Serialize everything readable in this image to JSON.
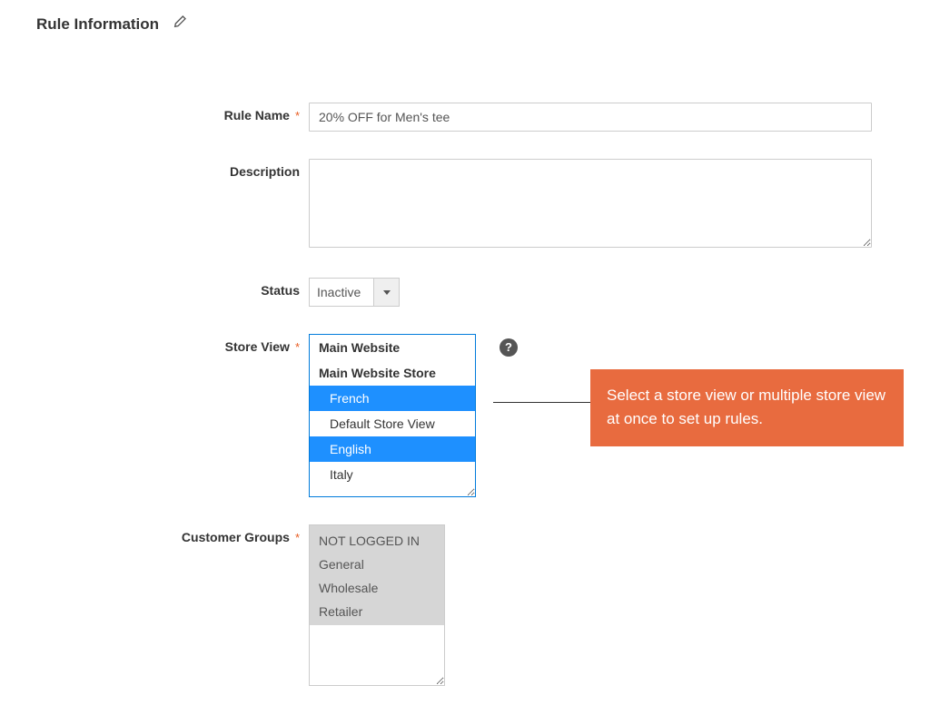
{
  "section": {
    "title": "Rule Information"
  },
  "labels": {
    "rule_name": "Rule Name",
    "description": "Description",
    "status": "Status",
    "store_view": "Store View",
    "customer_groups": "Customer Groups"
  },
  "fields": {
    "rule_name_value": "20% OFF for Men's tee",
    "description_value": "",
    "status_value": "Inactive"
  },
  "store_view": {
    "items": [
      {
        "label": "Main Website",
        "bold": true,
        "indent": 0,
        "selected": false
      },
      {
        "label": "Main Website Store",
        "bold": true,
        "indent": 0,
        "selected": false
      },
      {
        "label": "French",
        "bold": false,
        "indent": 2,
        "selected": true
      },
      {
        "label": "Default Store View",
        "bold": false,
        "indent": 2,
        "selected": false
      },
      {
        "label": "English",
        "bold": false,
        "indent": 2,
        "selected": true
      },
      {
        "label": "Italy",
        "bold": false,
        "indent": 2,
        "selected": false
      }
    ]
  },
  "customer_groups": {
    "items": [
      {
        "label": "NOT LOGGED IN",
        "selected": true
      },
      {
        "label": "General",
        "selected": true
      },
      {
        "label": "Wholesale",
        "selected": true
      },
      {
        "label": "Retailer",
        "selected": true
      }
    ]
  },
  "callout": {
    "text": "Select a store view or multiple store view at once to set up rules."
  },
  "help_icon": "?"
}
